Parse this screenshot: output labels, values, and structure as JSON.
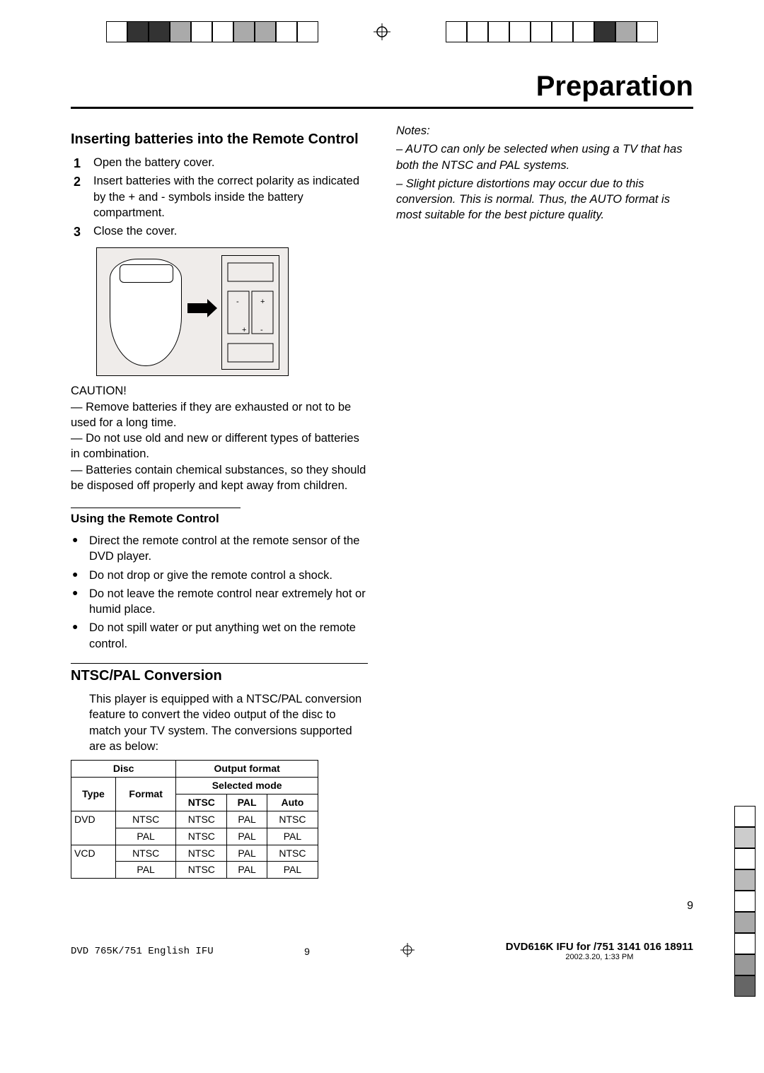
{
  "page": {
    "title": "Preparation",
    "page_number_bottom": "9",
    "footer_left_doc": "DVD 765K/751 English IFU",
    "footer_center": "9",
    "footer_right": "DVD616K IFU for /751      3141 016 18911",
    "footer_timestamp": "2002.3.20, 1:33 PM"
  },
  "left_col": {
    "h1": "Inserting batteries into the Remote Control",
    "steps": [
      "Open the battery cover.",
      "Insert batteries with the correct polarity as indicated by the + and - symbols inside the battery compartment.",
      "Close the cover."
    ],
    "caution_title": "CAUTION!",
    "caution_items": [
      "— Remove batteries if they are exhausted or not to be used for a long time.",
      "— Do not use old and new or different types of batteries in combination.",
      "— Batteries contain chemical substances, so they should be disposed off properly and kept away from children."
    ],
    "h2": "Using the Remote Control",
    "usage_bullets": [
      "Direct the remote control at the remote sensor of the DVD player.",
      "Do not drop or give the remote control a shock.",
      "Do not leave the remote control near extremely hot or humid place.",
      "Do not spill water or put anything wet on the remote control."
    ],
    "h3": "NTSC/PAL Conversion",
    "ntsc_intro": "This player is equipped with a NTSC/PAL conversion feature to convert the video output of the disc to match your TV system. The conversions supported are as below:"
  },
  "table": {
    "head_disc": "Disc",
    "head_output": "Output format",
    "head_type": "Type",
    "head_format": "Format",
    "head_selected": "Selected mode",
    "head_ntsc": "NTSC",
    "head_pal": "PAL",
    "head_auto": "Auto",
    "rows": [
      {
        "type": "DVD",
        "format": "NTSC",
        "ntsc": "NTSC",
        "pal": "PAL",
        "auto": "NTSC"
      },
      {
        "type": "",
        "format": "PAL",
        "ntsc": "NTSC",
        "pal": "PAL",
        "auto": "PAL"
      },
      {
        "type": "VCD",
        "format": "NTSC",
        "ntsc": "NTSC",
        "pal": "PAL",
        "auto": "NTSC"
      },
      {
        "type": "",
        "format": "PAL",
        "ntsc": "NTSC",
        "pal": "PAL",
        "auto": "PAL"
      }
    ]
  },
  "right_col": {
    "notes_label": "Notes:",
    "notes": [
      "– AUTO can only be selected when using a TV that has both the NTSC and PAL systems.",
      "– Slight picture distortions may occur due to this conversion. This is normal. Thus, the AUTO format is most suitable for the best picture quality."
    ]
  }
}
